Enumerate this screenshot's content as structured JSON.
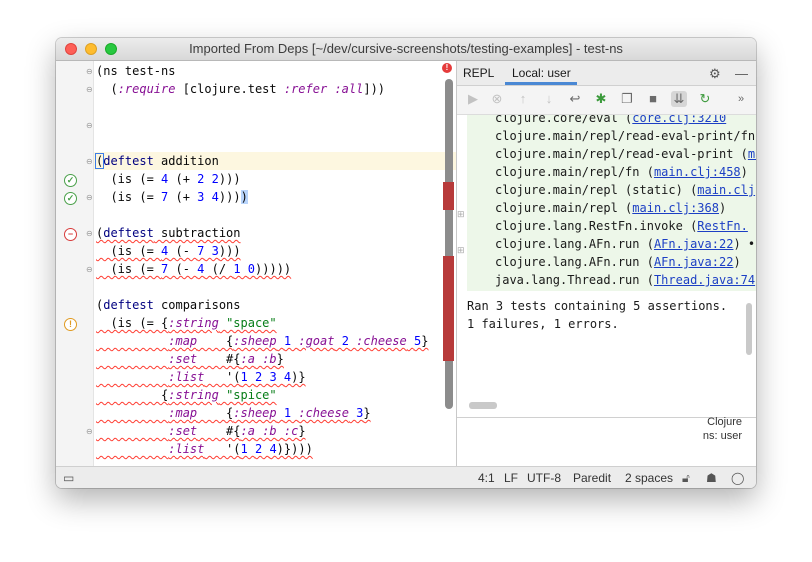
{
  "window": {
    "title": "Imported From Deps [~/dev/cursive-screenshots/testing-examples] - test-ns"
  },
  "editor": {
    "lines": [
      "(ns test-ns",
      "  (:require [clojure.test :refer :all]))",
      "",
      "(deftest addition",
      "  (is (= 4 (+ 2 2)))",
      "  (is (= 7 (+ 3 4))))",
      "",
      "(deftest subtraction",
      "  (is (= 4 (- 7 3)))",
      "  (is (= 7 (- 4 (/ 1 0)))))",
      "",
      "(deftest comparisons",
      "  (is (= {:string \"space\"",
      "          :map    {:sheep 1 :goat 2 :cheese 5}",
      "          :set    #{:a :b}",
      "          :list   '(1 2 3 4)}",
      "         {:string \"spice\"",
      "          :map    {:sheep 1 :cheese 3}",
      "          :set    #{:a :b :c}",
      "          :list   '(1 2 4)})))"
    ]
  },
  "repl": {
    "tabs": [
      "REPL",
      "Local: user"
    ],
    "trace": [
      {
        "pre": "clojure.core/eval (",
        "link": "core.clj:3210",
        "post": ""
      },
      {
        "pre": "clojure.main/repl/read-eval-print/fn",
        "link": "",
        "post": ""
      },
      {
        "pre": "clojure.main/repl/read-eval-print (",
        "link": "main.clj",
        "post": ""
      },
      {
        "pre": "clojure.main/repl/fn (",
        "link": "main.clj:458",
        "post": ")"
      },
      {
        "pre": "clojure.main/repl (static) (",
        "link": "main.clj",
        "post": ""
      },
      {
        "pre": "clojure.main/repl (",
        "link": "main.clj:368",
        "post": ")"
      },
      {
        "pre": "clojure.lang.RestFn.invoke (",
        "link": "RestFn.",
        "post": ""
      },
      {
        "pre": "clojure.lang.AFn.run (",
        "link": "AFn.java:22",
        "post": ") •"
      },
      {
        "pre": "clojure.lang.AFn.run (",
        "link": "AFn.java:22",
        "post": ")"
      },
      {
        "pre": "java.lang.Thread.run (",
        "link": "Thread.java:74",
        "post": ""
      }
    ],
    "summary1": "Ran 3 tests containing 5 assertions.",
    "summary2": "1 failures, 1 errors.",
    "lang": "Clojure",
    "ns": "ns: user"
  },
  "status": {
    "position": "4:1",
    "line_sep": "LF",
    "encoding": "UTF-8",
    "mode": "Paredit",
    "indent": "2 spaces"
  }
}
